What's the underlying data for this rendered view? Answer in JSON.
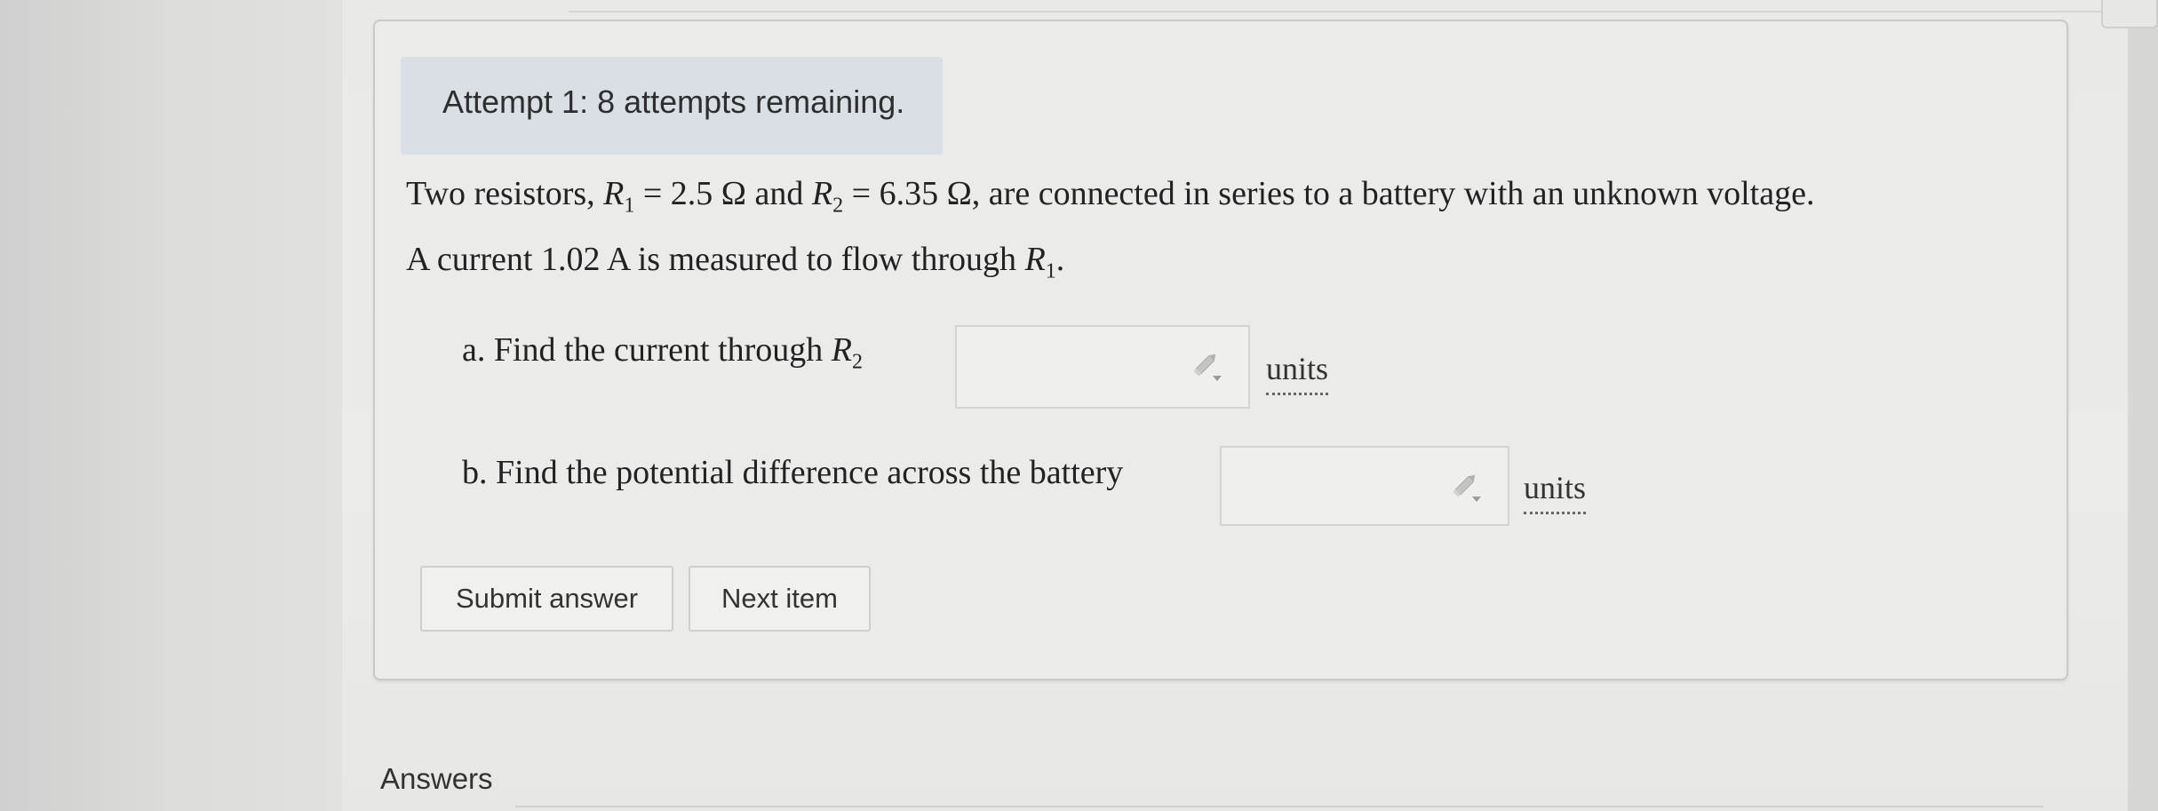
{
  "attempt": {
    "text": "Attempt 1: 8 attempts remaining."
  },
  "problem": {
    "line1": {
      "t1": "Two resistors, ",
      "r1_var": "R",
      "r1_sub": "1",
      "t2": " = 2.5 Ω and ",
      "r2_var": "R",
      "r2_sub": "2",
      "t3": " = 6.35 Ω, are connected in series to a battery with an unknown voltage."
    },
    "line2": {
      "t1": "A current 1.02 A is measured to flow through ",
      "r_var": "R",
      "r_sub": "1",
      "t2": "."
    }
  },
  "parts": {
    "a": {
      "label": "a. Find the current through ",
      "var": "R",
      "sub": "2",
      "units_label": "units",
      "value": ""
    },
    "b": {
      "label": "b. Find the potential difference across the battery",
      "units_label": "units",
      "value": ""
    }
  },
  "buttons": {
    "submit": "Submit answer",
    "next": "Next item"
  },
  "answers": {
    "heading": "Answers"
  },
  "icons": {
    "answer_editor": "pencil-dropdown-icon"
  },
  "colors": {
    "banner_bg": "#d9dfe4",
    "card_bg": "#ebebea",
    "input_border": "#d3d3d1"
  }
}
